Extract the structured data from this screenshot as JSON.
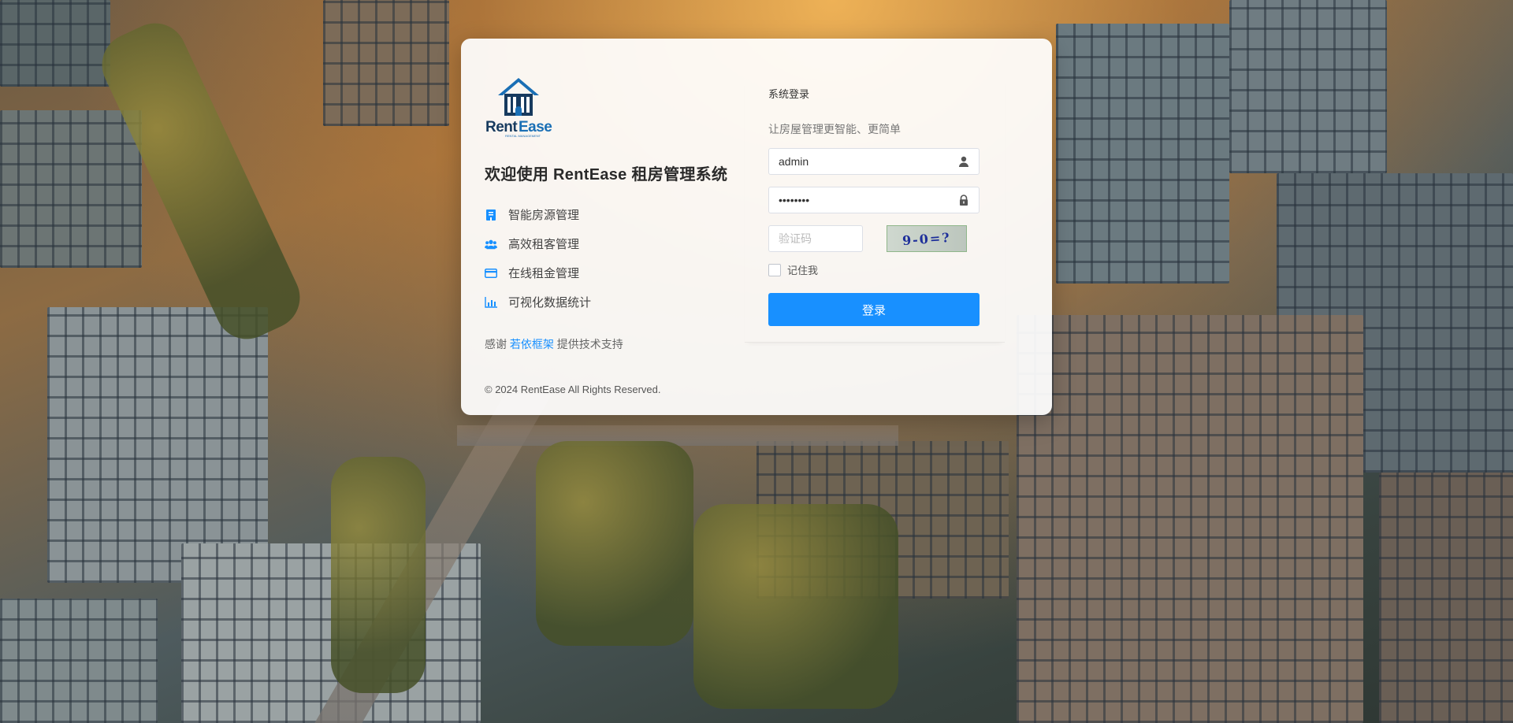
{
  "brand": {
    "name": "RentEase",
    "tagline": "RENTAL MANAGEMENT",
    "logo_icon": "house-building-icon",
    "accent_color": "#1890ff"
  },
  "intro": {
    "welcome": "欢迎使用 RentEase 租房管理系统",
    "features": [
      {
        "icon": "building-icon",
        "label": "智能房源管理"
      },
      {
        "icon": "users-icon",
        "label": "高效租客管理"
      },
      {
        "icon": "credit-card-icon",
        "label": "在线租金管理"
      },
      {
        "icon": "bar-chart-icon",
        "label": "可视化数据统计"
      }
    ],
    "thanks_prefix": "感谢",
    "thanks_link": "若依框架",
    "thanks_suffix": "提供技术支持",
    "copyright": "© 2024 RentEase All Rights Reserved."
  },
  "form": {
    "title": "系统登录",
    "subtitle": "让房屋管理更智能、更简单",
    "username_value": "admin",
    "username_icon": "user-icon",
    "password_value": "12345678",
    "password_icon": "lock-icon",
    "captcha_placeholder": "验证码",
    "captcha_image_text": "9-0=?",
    "remember_label": "记住我",
    "remember_checked": false,
    "submit_label": "登录"
  }
}
